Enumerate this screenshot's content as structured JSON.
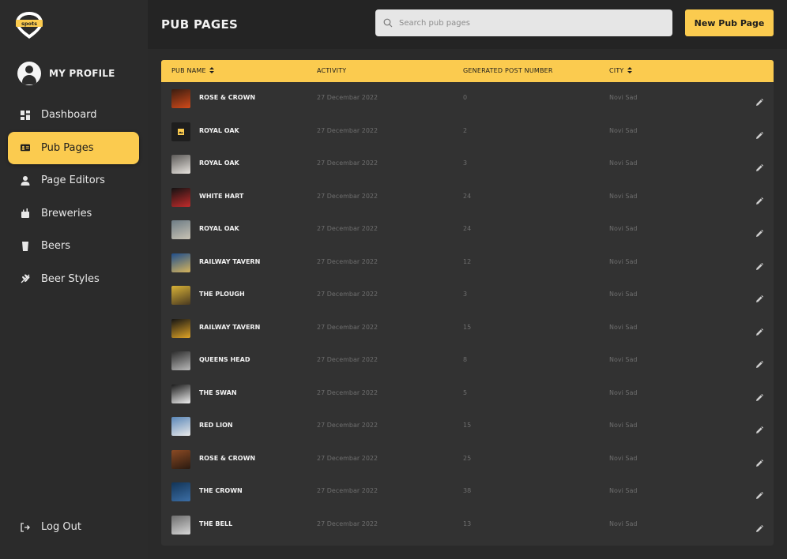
{
  "app": {
    "logo_text": "spots",
    "brand_color": "#fbcb4f"
  },
  "sidebar": {
    "profile_label": "MY PROFILE",
    "items": [
      {
        "label": "Dashboard",
        "icon": "dashboard-icon",
        "active": false
      },
      {
        "label": "Pub Pages",
        "icon": "id-card-icon",
        "active": true
      },
      {
        "label": "Page Editors",
        "icon": "user-icon",
        "active": false
      },
      {
        "label": "Breweries",
        "icon": "brewery-icon",
        "active": false
      },
      {
        "label": "Beers",
        "icon": "glass-icon",
        "active": false
      },
      {
        "label": "Beer Styles",
        "icon": "hop-icon",
        "active": false
      }
    ],
    "logout_label": "Log Out"
  },
  "header": {
    "title": "PUB PAGES",
    "search_placeholder": "Search pub pages",
    "new_button": "New Pub Page"
  },
  "table": {
    "columns": [
      "PUB NAME",
      "ACTIVITY",
      "GENERATED POST NUMBER",
      "CITY"
    ],
    "rows": [
      {
        "name": "ROSE & CROWN",
        "activity": "27 Decembar 2022",
        "posts": "0",
        "city": "Novi Sad",
        "thumb": [
          "#3a1d10",
          "#d24a1a"
        ]
      },
      {
        "name": "ROYAL OAK",
        "activity": "27 Decembar 2022",
        "posts": "2",
        "city": "Novi Sad",
        "thumb": [
          "#1e1e1e",
          "#1e1e1e"
        ]
      },
      {
        "name": "ROYAL OAK",
        "activity": "27 Decembar 2022",
        "posts": "3",
        "city": "Novi Sad",
        "thumb": [
          "#5c5a58",
          "#e7e3de"
        ]
      },
      {
        "name": "WHITE HART",
        "activity": "27 Decembar 2022",
        "posts": "24",
        "city": "Novi Sad",
        "thumb": [
          "#121212",
          "#c22b2b"
        ]
      },
      {
        "name": "ROYAL OAK",
        "activity": "27 Decembar 2022",
        "posts": "24",
        "city": "Novi Sad",
        "thumb": [
          "#6d7c85",
          "#c9c3b4"
        ]
      },
      {
        "name": "RAILWAY TAVERN",
        "activity": "27 Decembar 2022",
        "posts": "12",
        "city": "Novi Sad",
        "thumb": [
          "#1f4e8c",
          "#d6b45c"
        ]
      },
      {
        "name": "THE PLOUGH",
        "activity": "27 Decembar 2022",
        "posts": "3",
        "city": "Novi Sad",
        "thumb": [
          "#d8b237",
          "#4a3a20"
        ]
      },
      {
        "name": "RAILWAY TAVERN",
        "activity": "27 Decembar 2022",
        "posts": "15",
        "city": "Novi Sad",
        "thumb": [
          "#141414",
          "#e0a426"
        ]
      },
      {
        "name": "QUEENS HEAD",
        "activity": "27 Decembar 2022",
        "posts": "8",
        "city": "Novi Sad",
        "thumb": [
          "#2c2c2c",
          "#b9b9b9"
        ]
      },
      {
        "name": "THE SWAN",
        "activity": "27 Decembar 2022",
        "posts": "5",
        "city": "Novi Sad",
        "thumb": [
          "#1a1a1a",
          "#f0f0f0"
        ]
      },
      {
        "name": "RED LION",
        "activity": "27 Decembar 2022",
        "posts": "15",
        "city": "Novi Sad",
        "thumb": [
          "#5a87b8",
          "#e9e9e9"
        ]
      },
      {
        "name": "ROSE & CROWN",
        "activity": "27 Decembar 2022",
        "posts": "25",
        "city": "Novi Sad",
        "thumb": [
          "#8b4a24",
          "#2a1a10"
        ]
      },
      {
        "name": "THE CROWN",
        "activity": "27 Decembar 2022",
        "posts": "38",
        "city": "Novi Sad",
        "thumb": [
          "#123457",
          "#3c6ea5"
        ]
      },
      {
        "name": "THE BELL",
        "activity": "27 Decembar 2022",
        "posts": "13",
        "city": "Novi Sad",
        "thumb": [
          "#6d6d6d",
          "#d7d7d7"
        ]
      }
    ]
  }
}
